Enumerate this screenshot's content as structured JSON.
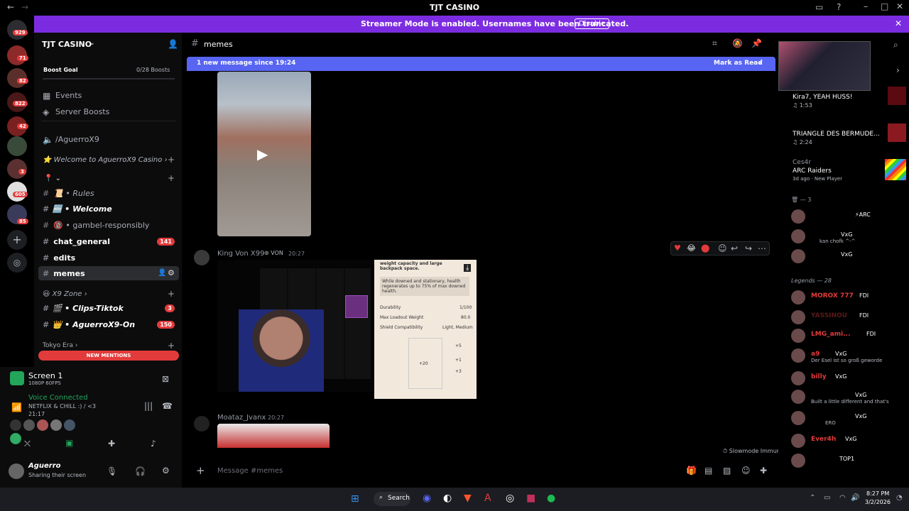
{
  "window": {
    "title": "TJT CASINO"
  },
  "streamer": {
    "message": "Streamer Mode is enabled. Usernames have been truncated.",
    "disable_label": "Disable"
  },
  "servers": {
    "badges": [
      "929",
      "71",
      "82",
      "822",
      "42",
      "3",
      "605",
      "85"
    ]
  },
  "guild": {
    "name": "TJT CASINO",
    "boost_goal_label": "Boost Goal",
    "boost_count": "0/28 Boosts",
    "events": "Events",
    "server_boosts": "Server Boosts",
    "voice_link": "/AguerroX9",
    "welcome_category": "Welcome to AguerroX9 Casino",
    "channels": [
      {
        "label": "Rules",
        "prefix": "📜 •"
      },
      {
        "label": "Welcome",
        "prefix": "🆕 •"
      },
      {
        "label": "gambel-responsibly",
        "prefix": "🔞 •"
      },
      {
        "label": "chat_general",
        "badge": "141"
      },
      {
        "label": "edits"
      },
      {
        "label": "memes"
      }
    ],
    "x9_zone": "X9 Zone",
    "zone_channels": [
      {
        "label": "Clips-Tiktok",
        "prefix": "🎬 •",
        "badge": "3"
      },
      {
        "label": "AguerroX9-On",
        "prefix": "👑 •",
        "badge": "150"
      }
    ],
    "tokyo_era": "Tokyo Era",
    "new_mentions": "NEW MENTIONS"
  },
  "screen": {
    "title": "Screen 1",
    "quality": "1080P 60FPS"
  },
  "voice": {
    "status": "Voice Connected",
    "channel": "NETFLIX & CHILL :) / <3",
    "timer": "21:17"
  },
  "user": {
    "name": "Aguerro",
    "status": "Sharing their screen"
  },
  "channel": {
    "name": "memes",
    "new_message_banner": "1 new message since 19:24",
    "mark_read": "Mark as Read",
    "composer_placeholder": "Message #memes",
    "slowmode": "Slowmode Immune"
  },
  "messages": [
    {
      "author": "King Von X99",
      "tag": "VON",
      "time": "20:27"
    },
    {
      "author": "Moataz_Jvanx",
      "time": "20:27"
    }
  ],
  "attachment": {
    "desc": "While downed and stationary, health regenerates up to 75% of max downed health.",
    "header_text": "weight capacity and large backpack space.",
    "durability_label": "Durability",
    "durability_value": "1/100",
    "weight_label": "Max Loadout Weight",
    "weight_value": "80.0",
    "shield_label": "Shield Compatibility",
    "shield_value": "Light, Medium",
    "slot_a": "+20",
    "slot_b": "+5",
    "slot_c": "+1",
    "slot_d": "+3"
  },
  "activities": [
    {
      "title": "Kira7, YEAH HUSS!",
      "sub": "1:53"
    },
    {
      "title": "TRIANGLE DES BERMUDE...",
      "sub": "2:24"
    },
    {
      "name": "Ces4r",
      "title": "ARC Raiders",
      "sub": "3d ago",
      "sub2": "New Player"
    }
  ],
  "members": {
    "group_count": "3",
    "legends_header": "Legends — 28",
    "top": [
      {
        "name": "",
        "tag": "⚡ARC"
      },
      {
        "name": "",
        "tag": "VxG",
        "status": "kan chofk ^-^"
      },
      {
        "name": "",
        "tag": "VxG"
      }
    ],
    "list": [
      {
        "name": "MOROX 777",
        "tag": "FDI"
      },
      {
        "name": "YASSINOU",
        "tag": "FDI"
      },
      {
        "name": "LMG_ami...",
        "tag": "FDI"
      },
      {
        "name": "a9",
        "tag": "VxG",
        "status": "Der Esel ist so groß geworde"
      },
      {
        "name": "billy",
        "tag": "VxG"
      },
      {
        "name": "",
        "tag": "VxG",
        "status": "Built a little different and that's"
      },
      {
        "name": "",
        "tag": "VxG",
        "status": "ERO"
      },
      {
        "name": "Ever4h",
        "tag": "VxG"
      },
      {
        "name": "",
        "tag": "TOP1"
      }
    ]
  },
  "taskbar": {
    "search": "Search",
    "time": "8:27 PM",
    "date": "3/2/2026"
  }
}
